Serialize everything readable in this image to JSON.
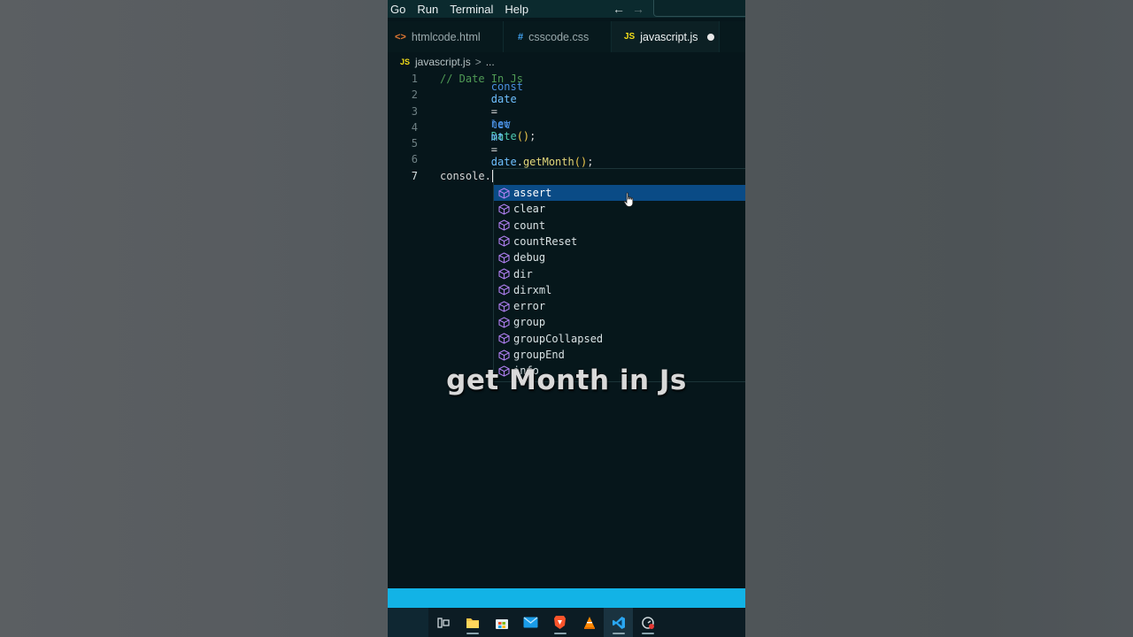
{
  "menubar": {
    "items": [
      "Go",
      "Run",
      "Terminal",
      "Help"
    ],
    "back_arrow": "←",
    "forward_arrow": "→"
  },
  "tabs": [
    {
      "icon": "<>",
      "label": "htmlcode.html"
    },
    {
      "icon": "#",
      "label": "csscode.css"
    },
    {
      "icon": "JS",
      "label": "javascript.js",
      "dirty": true
    }
  ],
  "breadcrumb": {
    "icon": "JS",
    "file": "javascript.js",
    "separator": ">",
    "rest": "..."
  },
  "editor": {
    "line_numbers": [
      "1",
      "2",
      "3",
      "4",
      "5",
      "6",
      "7"
    ],
    "line1": {
      "comment": "// Date In Js"
    },
    "line3": {
      "kw": "const",
      "var": "date",
      "op": "=",
      "kw2": "new",
      "cls": "Date",
      "paren": "()",
      "end": ";"
    },
    "line5": {
      "kw": "let",
      "var": "mt",
      "op": "=",
      "obj": "date",
      "dot": ".",
      "fn": "getMonth",
      "paren": "()",
      "end": ";"
    },
    "line7": {
      "text": "console."
    }
  },
  "suggestions": [
    "assert",
    "clear",
    "count",
    "countReset",
    "debug",
    "dir",
    "dirxml",
    "error",
    "group",
    "groupCollapsed",
    "groupEnd",
    "info"
  ],
  "suggestions_selected_index": 0,
  "overlay": {
    "caption": "get Month in Js"
  },
  "taskbar": {
    "icons": [
      "task-view-icon",
      "file-explorer-icon",
      "store-icon",
      "mail-icon",
      "brave-icon",
      "vlc-icon",
      "vscode-icon",
      "app-icon"
    ]
  },
  "colors": {
    "accent_status": "#12b3e6",
    "selection": "#0a4b86",
    "editor_bg": "#06161b"
  }
}
